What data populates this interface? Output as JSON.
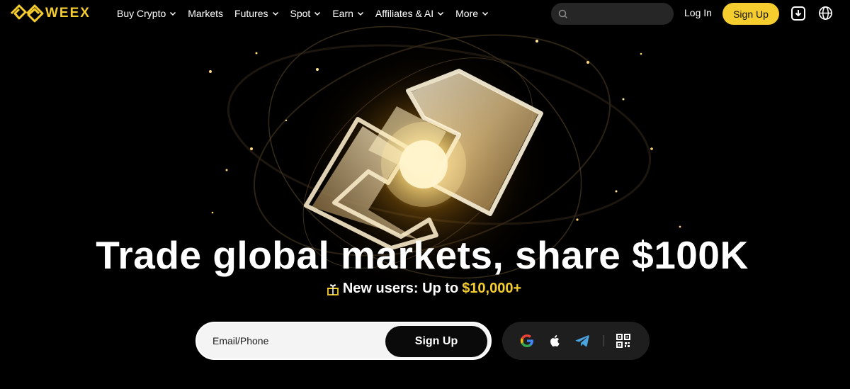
{
  "brand": {
    "name": "WEEX",
    "accent_color": "#f5cd2e"
  },
  "nav": {
    "items": [
      {
        "label": "Buy Crypto",
        "has_dropdown": true
      },
      {
        "label": "Markets",
        "has_dropdown": false
      },
      {
        "label": "Futures",
        "has_dropdown": true
      },
      {
        "label": "Spot",
        "has_dropdown": true
      },
      {
        "label": "Earn",
        "has_dropdown": true
      },
      {
        "label": "Affiliates & AI",
        "has_dropdown": true
      },
      {
        "label": "More",
        "has_dropdown": true
      }
    ]
  },
  "header": {
    "search_placeholder": "",
    "login_label": "Log In",
    "signup_label": "Sign Up",
    "icons": [
      "search-icon",
      "download-icon",
      "globe-icon"
    ]
  },
  "hero": {
    "headline": "Trade global markets, share $100K",
    "subline_prefix": "New users: Up to",
    "subline_amount": "$10,000+",
    "gift_icon": "gift-icon"
  },
  "signup_form": {
    "input_placeholder": "Email/Phone",
    "button_label": "Sign Up"
  },
  "social_login": {
    "providers": [
      "google-icon",
      "apple-icon",
      "telegram-icon"
    ],
    "qr_icon": "qr-code-icon"
  }
}
